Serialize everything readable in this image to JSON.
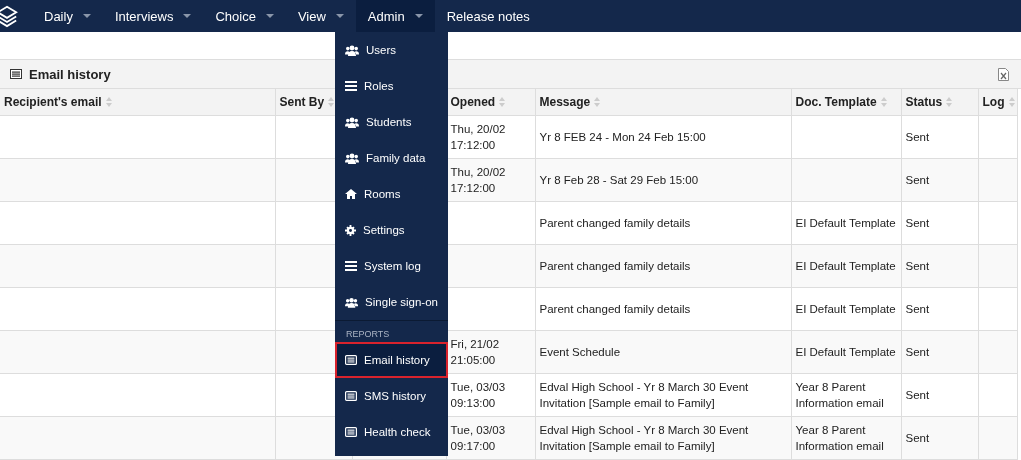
{
  "navbar": {
    "items": [
      {
        "label": "Daily",
        "dropdown": true,
        "selected": false
      },
      {
        "label": "Interviews",
        "dropdown": true,
        "selected": false
      },
      {
        "label": "Choice",
        "dropdown": true,
        "selected": false
      },
      {
        "label": "View",
        "dropdown": true,
        "selected": false
      },
      {
        "label": "Admin",
        "dropdown": true,
        "selected": true
      },
      {
        "label": "Release notes",
        "dropdown": false,
        "selected": false
      }
    ]
  },
  "admin_menu": {
    "items": [
      {
        "kind": "people",
        "label": "Users",
        "selected": false
      },
      {
        "kind": "list",
        "label": "Roles",
        "selected": false
      },
      {
        "kind": "people",
        "label": "Students",
        "selected": false
      },
      {
        "kind": "people",
        "label": "Family data",
        "selected": false
      },
      {
        "kind": "home",
        "label": "Rooms",
        "selected": false
      },
      {
        "kind": "gear",
        "label": "Settings",
        "selected": false
      },
      {
        "kind": "list",
        "label": "System log",
        "selected": false
      },
      {
        "kind": "people",
        "label": "Single sign-on",
        "selected": false
      },
      {
        "kind": "header",
        "label": "REPORTS"
      },
      {
        "kind": "report",
        "label": "Email history",
        "selected": true
      },
      {
        "kind": "report",
        "label": "SMS history",
        "selected": false
      },
      {
        "kind": "report",
        "label": "Health check",
        "selected": false
      }
    ]
  },
  "panel": {
    "title": "Email history"
  },
  "table": {
    "columns": [
      "Recipient's email",
      "Sent By",
      "Opened",
      "Message",
      "Doc. Template",
      "Status",
      "Log"
    ],
    "rows": [
      {
        "opened": "Thu, 20/02\n17:12:00",
        "message": "Yr 8 FEB 24 - Mon 24 Feb 15:00",
        "doc_template": "",
        "status": "Sent"
      },
      {
        "opened": "Thu, 20/02\n17:12:00",
        "message": "Yr 8 Feb 28 - Sat 29 Feb 15:00",
        "doc_template": "",
        "status": "Sent"
      },
      {
        "opened": "",
        "message": "Parent changed family details",
        "doc_template": "EI Default Template",
        "status": "Sent"
      },
      {
        "opened": "",
        "message": "Parent changed family details",
        "doc_template": "EI Default Template",
        "status": "Sent"
      },
      {
        "opened": "",
        "message": "Parent changed family details",
        "doc_template": "EI Default Template",
        "status": "Sent"
      },
      {
        "opened": "Fri, 21/02\n21:05:00",
        "message": "Event Schedule",
        "doc_template": "EI Default Template",
        "status": "Sent"
      },
      {
        "opened": "Tue, 03/03\n09:13:00",
        "message": "Edval High School - Yr 8 March 30 Event Invitation [Sample email to Family]",
        "doc_template": "Year 8 Parent Information email",
        "status": "Sent"
      },
      {
        "opened": "Tue, 03/03\n09:17:00",
        "message": "Edval High School - Yr 8 March 30 Event Invitation [Sample email to Family]",
        "doc_template": "Year 8 Parent Information email",
        "status": "Sent"
      }
    ]
  }
}
